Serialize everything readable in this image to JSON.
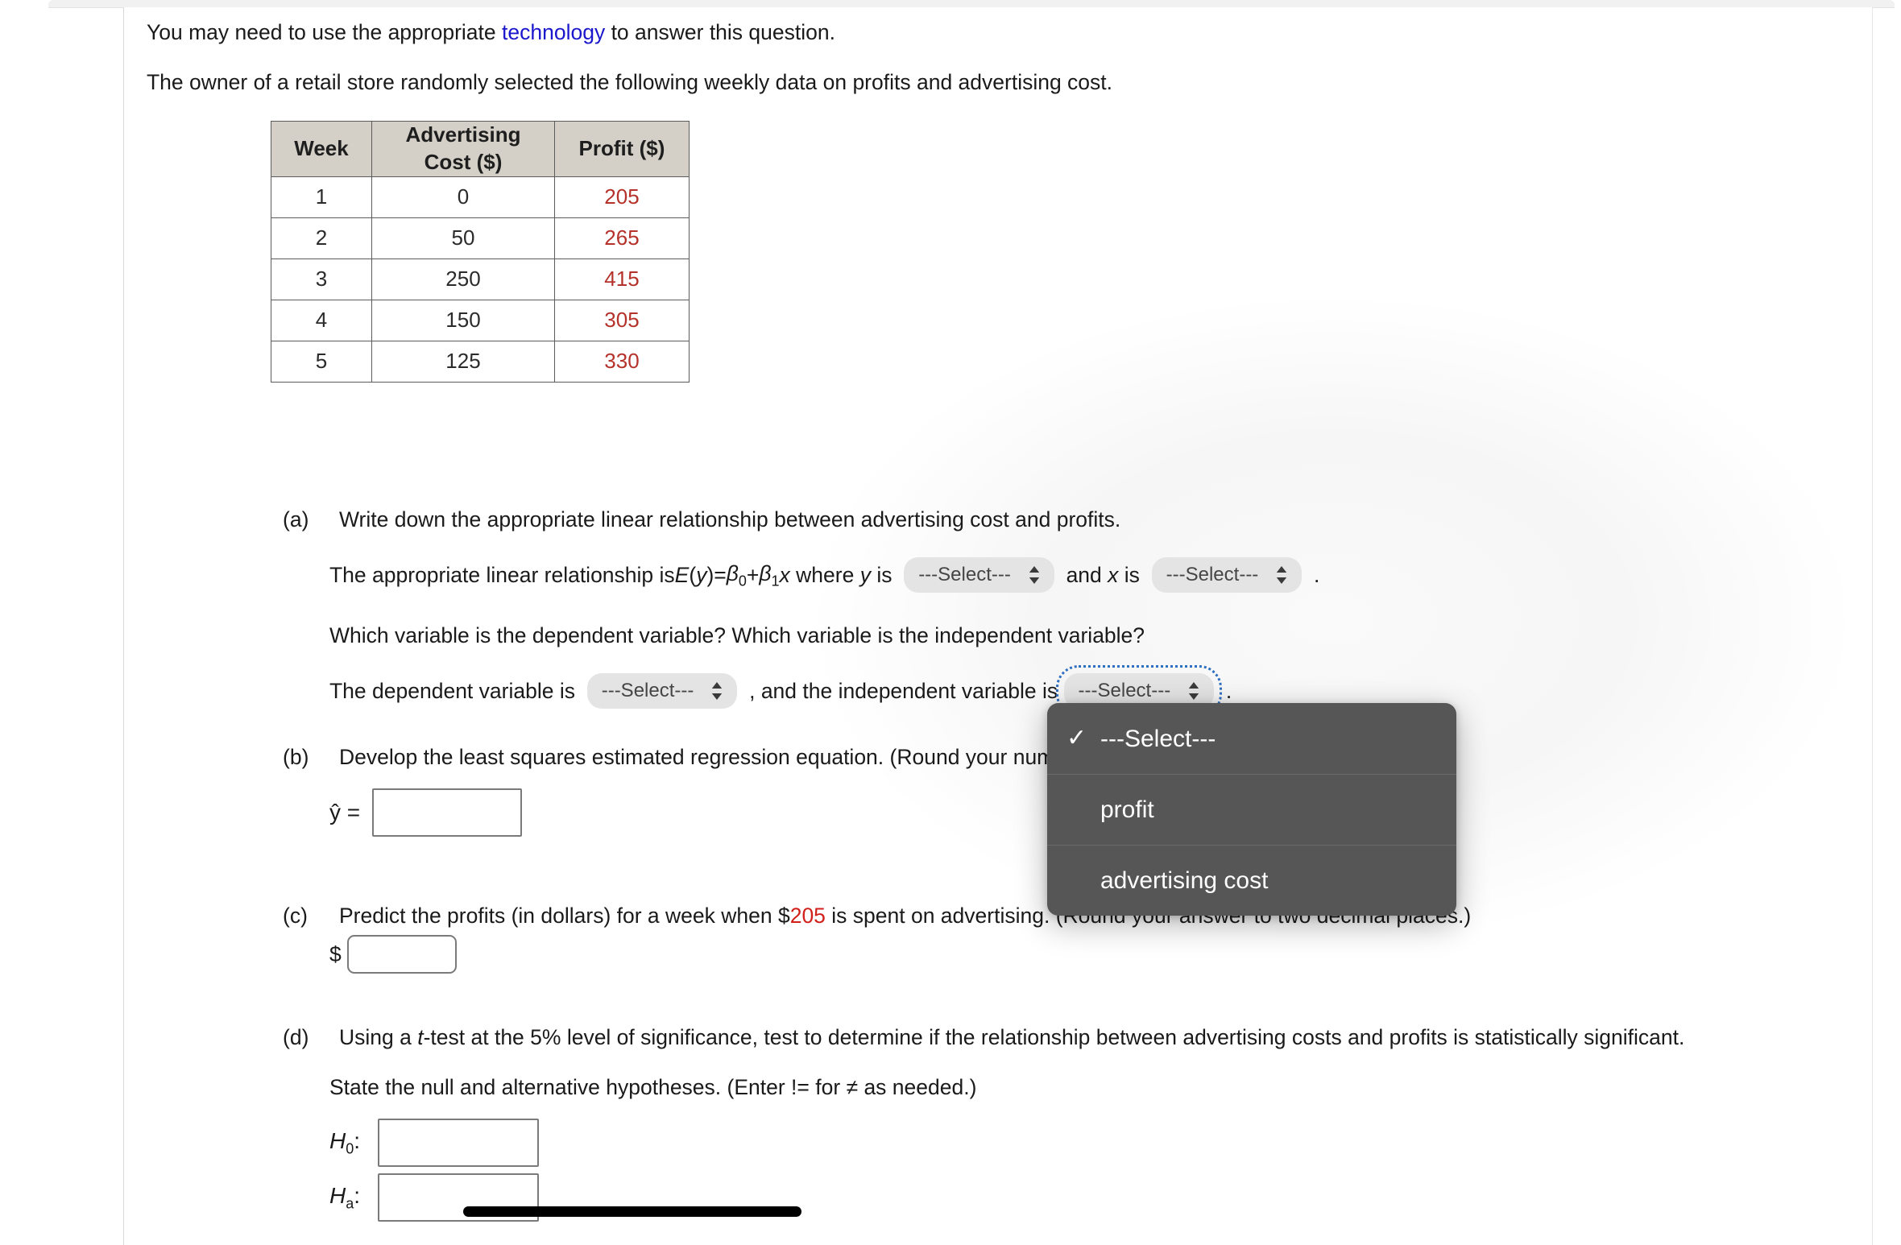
{
  "intro": {
    "line1_pre": "You may need to use the appropriate ",
    "line1_link": "technology",
    "line1_post": " to answer this question.",
    "line2": "The owner of a retail store randomly selected the following weekly data on profits and advertising cost."
  },
  "table": {
    "headers": [
      "Week",
      "Advertising Cost ($)",
      "Profit ($)"
    ],
    "rows": [
      {
        "week": "1",
        "advertising_cost": "0",
        "profit": "205"
      },
      {
        "week": "2",
        "advertising_cost": "50",
        "profit": "265"
      },
      {
        "week": "3",
        "advertising_cost": "250",
        "profit": "415"
      },
      {
        "week": "4",
        "advertising_cost": "150",
        "profit": "305"
      },
      {
        "week": "5",
        "advertising_cost": "125",
        "profit": "330"
      }
    ]
  },
  "parts": {
    "a": {
      "label": "(a)",
      "prompt": "Write down the appropriate linear relationship between advertising cost and profits.",
      "rel_pre": "The appropriate linear relationship is ",
      "rel_eq_E": "E",
      "rel_eq_y": "(y)",
      "rel_eq_eq": " = ",
      "rel_beta0": "β",
      "rel_beta0_sub": "0",
      "rel_plus": " + ",
      "rel_beta1": "β",
      "rel_beta1_sub": "1",
      "rel_x": "x",
      "rel_where_y": " where y is",
      "rel_and_x": "and x is",
      "rel_period": ".",
      "select_y_value": "---Select---",
      "select_x_value": "---Select---",
      "question2": "Which variable is the dependent variable? Which variable is the independent variable?",
      "dep_pre": "The dependent variable is",
      "dep_select_value": "---Select---",
      "dep_mid": ", and the independent variable is",
      "indep_select_value": "---Select---"
    },
    "b": {
      "label": "(b)",
      "prompt": "Develop the least squares estimated regression equation. (Round your numerical values to two decimal places.)",
      "yhat_label": "ŷ =",
      "answer_value": ""
    },
    "c": {
      "label": "(c)",
      "prompt_pre": "Predict the profits (in dollars) for a week when $",
      "prompt_amount": "205",
      "prompt_post": " is spent on advertising. (Round your answer to two decimal places.)",
      "dollar_sign": "$",
      "answer_value": ""
    },
    "d": {
      "label": "(d)",
      "prompt_pre": "Using a ",
      "prompt_t": "t",
      "prompt_post": "-test at the 5% level of significance, test to determine if the relationship between advertising costs and profits is statistically significant.",
      "state_hyp": "State the null and alternative hypotheses. (Enter != for ≠ as needed.)",
      "h0_label_H": "H",
      "h0_label_sub": "0",
      "h0_label_colon": ":",
      "ha_label_H": "H",
      "ha_label_sub": "a",
      "ha_label_colon": ":",
      "h0_value": "",
      "ha_value": ""
    }
  },
  "dropdown": {
    "open": true,
    "checkmark": "✓",
    "items": [
      {
        "label": "---Select---",
        "checked": true
      },
      {
        "label": "profit",
        "checked": false
      },
      {
        "label": "advertising cost",
        "checked": false
      }
    ]
  },
  "colors": {
    "link": "#1a17cc",
    "profit_red": "#b5322b",
    "highlight_red": "#d1201a",
    "table_header_bg": "#d4d0c8",
    "dropdown_bg": "#565656",
    "focus_ring": "#2f6fc0"
  }
}
